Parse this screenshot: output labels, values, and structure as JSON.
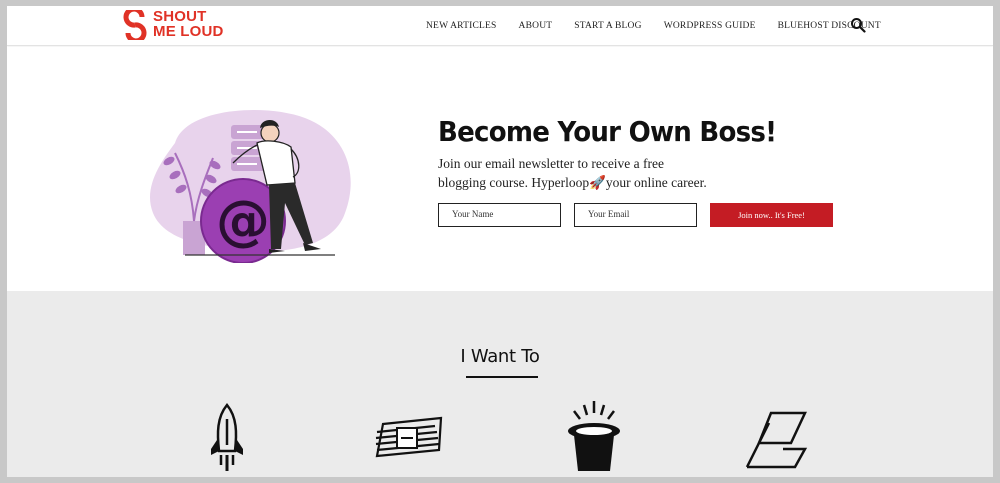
{
  "brand": {
    "logo_line1": "SHOUT",
    "logo_line2": "ME LOUD",
    "color": "#e03226"
  },
  "nav": {
    "items": [
      {
        "label": "NEW ARTICLES"
      },
      {
        "label": "ABOUT"
      },
      {
        "label": "START A BLOG"
      },
      {
        "label": "WORDPRESS GUIDE"
      },
      {
        "label": "BLUEHOST DISCOUNT"
      }
    ],
    "search_icon": "search-icon"
  },
  "hero": {
    "title": "Become Your Own Boss!",
    "text_line1": "Join our email newsletter to receive a free",
    "text_line2": "blogging course. Hyperloop🚀your online career.",
    "name_placeholder": "Your Name",
    "email_placeholder": "Your Email",
    "button_label": "Join now.. It's Free!",
    "button_color": "#c41c24",
    "illustration": "man-leaning-on-at-sign-illustration"
  },
  "want": {
    "title": "I Want To",
    "icons": [
      "rocket-icon",
      "money-stack-icon",
      "magic-hat-icon",
      "blog-platform-icon"
    ]
  }
}
